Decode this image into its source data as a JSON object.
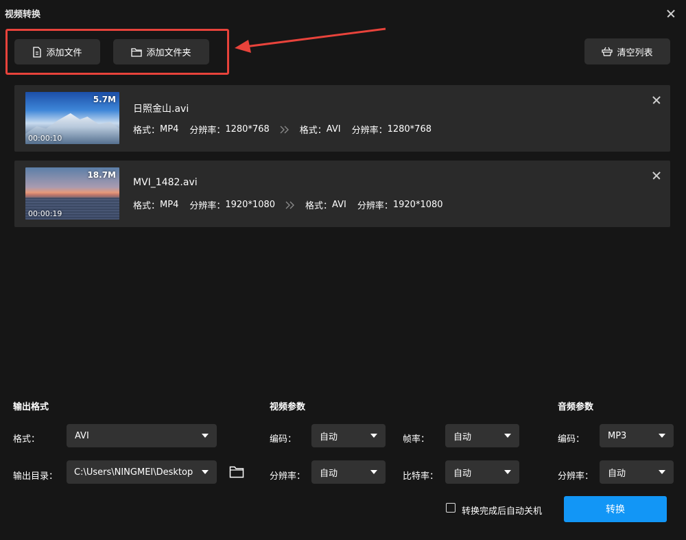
{
  "window": {
    "title": "视频转换"
  },
  "toolbar": {
    "add_file_label": "添加文件",
    "add_folder_label": "添加文件夹",
    "clear_list_label": "清空列表"
  },
  "annotation": {
    "highlight_color": "#e8433b"
  },
  "files": [
    {
      "name": "日照金山.avi",
      "size": "5.7M",
      "duration": "00:00:10",
      "src_format_label": "格式：",
      "src_format": "MP4",
      "src_res_label": "分辨率：",
      "src_res": "1280*768",
      "dst_format_label": "格式：",
      "dst_format": "AVI",
      "dst_res_label": "分辨率：",
      "dst_res": "1280*768"
    },
    {
      "name": "MVI_1482.avi",
      "size": "18.7M",
      "duration": "00:00:19",
      "src_format_label": "格式：",
      "src_format": "MP4",
      "src_res_label": "分辨率：",
      "src_res": "1920*1080",
      "dst_format_label": "格式：",
      "dst_format": "AVI",
      "dst_res_label": "分辨率：",
      "dst_res": "1920*1080"
    }
  ],
  "output": {
    "heading": "输出格式",
    "format_label": "格式：",
    "format_value": "AVI",
    "dir_label": "输出目录：",
    "dir_value": "C:\\Users\\NINGMEI\\Desktop"
  },
  "video": {
    "heading": "视频参数",
    "codec_label": "编码：",
    "codec_value": "自动",
    "res_label": "分辨率：",
    "res_value": "自动",
    "fps_label": "帧率：",
    "fps_value": "自动",
    "bitrate_label": "比特率：",
    "bitrate_value": "自动"
  },
  "audio": {
    "heading": "音频参数",
    "codec_label": "编码：",
    "codec_value": "MP3",
    "res_label": "分辨率：",
    "res_value": "自动"
  },
  "footer": {
    "shutdown_label": "转换完成后自动关机",
    "convert_label": "转换",
    "accent_color": "#1296f6"
  }
}
